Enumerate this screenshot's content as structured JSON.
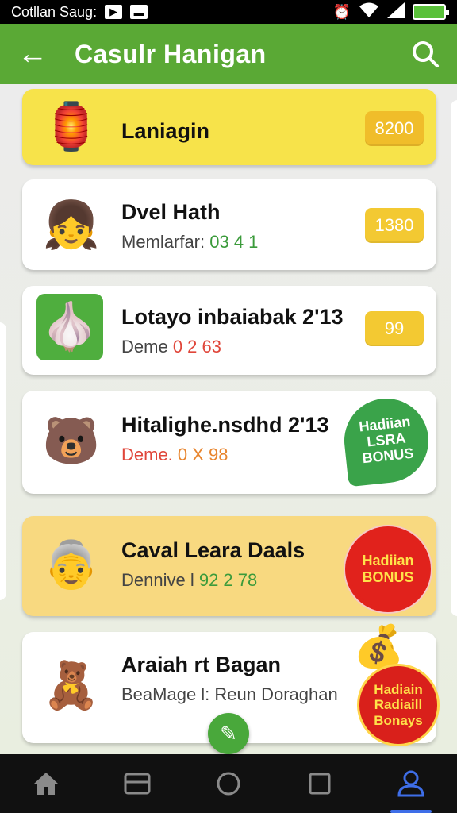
{
  "status_bar": {
    "carrier": "Cotllan Saug:",
    "left_icons": [
      "play-icon",
      "message-icon"
    ],
    "right_icons": [
      "alarm-icon",
      "wifi-icon",
      "signal-icon",
      "battery-icon"
    ]
  },
  "app_bar": {
    "title": "Casulr Hanigan"
  },
  "colors": {
    "primary": "#5aa935",
    "pill": "#f3c932",
    "badge_green": "#3aa34a",
    "badge_red": "#e1221c",
    "highlight_card": "#f8d980",
    "first_card": "#f7e34a"
  },
  "items": [
    {
      "name": "Laniagin",
      "icon": "lantern-icon",
      "value": "8200"
    },
    {
      "name": "Dvel Hath",
      "sub_label": "Memlarfar:",
      "sub_value": "03 4 1",
      "icon": "girl-avatar-icon",
      "value": "1380"
    },
    {
      "name": "Lotayo inbaiabak 2'13",
      "sub_label": "Deme",
      "sub_value": "0 2 63",
      "icon": "garlic-icon",
      "value": "99"
    },
    {
      "name": "Hitalighe.nsdhd 2'13",
      "sub_label": "Deme.",
      "sub_value": "0 X 98",
      "icon": "explorer-bear-icon",
      "badge": "Hadiian LSRA BONUS"
    },
    {
      "name": "Caval Leara Daals",
      "sub_label": "Dennive l",
      "sub_value": "92 2 78",
      "icon": "grandma-icon",
      "badge": "Hadiian BONUS"
    },
    {
      "name": "Araiah rt Bagan",
      "sub_label": "BeaMage l: Reun Doraghan",
      "sub_value": "",
      "icon": "teddy-bear-icon",
      "badge": "Hadiain Radiaill Bonays"
    }
  ],
  "nav": [
    {
      "name": "home",
      "icon": "home-icon"
    },
    {
      "name": "recent",
      "icon": "recent-icon"
    },
    {
      "name": "circle",
      "icon": "circle-icon"
    },
    {
      "name": "square",
      "icon": "square-icon"
    },
    {
      "name": "profile",
      "icon": "profile-icon",
      "active": true
    }
  ]
}
